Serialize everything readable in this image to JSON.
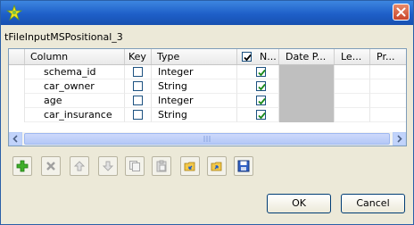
{
  "window": {
    "component_title": "tFileInputMSPositional_3",
    "icon": "talend-star-icon"
  },
  "table": {
    "headers": {
      "column": "Column",
      "key": "Key",
      "type": "Type",
      "nullable": "N...",
      "date_pattern": "Date P...",
      "length": "Le...",
      "precision": "Pr..."
    },
    "header_nullable_checked": true,
    "rows": [
      {
        "column": "schema_id",
        "key": false,
        "type": "Integer",
        "nullable": true
      },
      {
        "column": "car_owner",
        "key": false,
        "type": "String",
        "nullable": true
      },
      {
        "column": "age",
        "key": false,
        "type": "Integer",
        "nullable": true
      },
      {
        "column": "car_insurance",
        "key": false,
        "type": "String",
        "nullable": true
      }
    ]
  },
  "toolbar": {
    "buttons": [
      "add-icon",
      "remove-icon",
      "move-up-icon",
      "move-down-icon",
      "copy-icon",
      "paste-icon",
      "import-schema-icon",
      "export-schema-icon",
      "save-icon"
    ]
  },
  "dialog": {
    "ok_label": "OK",
    "cancel_label": "Cancel"
  },
  "colors": {
    "titlebar": "#1e5fc8",
    "selected_check": "#21a121",
    "disabled_cell": "#bfbfbf"
  }
}
